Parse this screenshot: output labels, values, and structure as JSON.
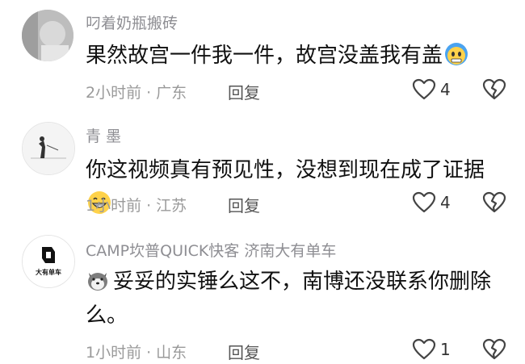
{
  "comments": [
    {
      "username": "叼着奶瓶搬砖",
      "text": "果然故宫一件我一件，故宫没盖我有盖",
      "emoji": "cold-face-emoji",
      "time": "2小时前",
      "location": "广东",
      "reply_label": "回复",
      "like_count": "4"
    },
    {
      "username": "青  墨",
      "text": "你这视频真有预见性，没想到现在成了证据",
      "emoji": "grinning-face-emoji",
      "time": "1小时前",
      "location": "江苏",
      "reply_label": "回复",
      "like_count": "4"
    },
    {
      "username": "CAMP坎普QUICK快客 济南大有单车",
      "avatar_text": "大有单车",
      "text": "妥妥的实锤么这不，南博还没联系你删除么。",
      "emoji": "husky-dog-emoji",
      "time": "1小时前",
      "location": "山东",
      "reply_label": "回复",
      "like_count": "1"
    }
  ],
  "colors": {
    "username": "#8e8e93",
    "body": "#111111",
    "meta": "#9a9a9a"
  }
}
